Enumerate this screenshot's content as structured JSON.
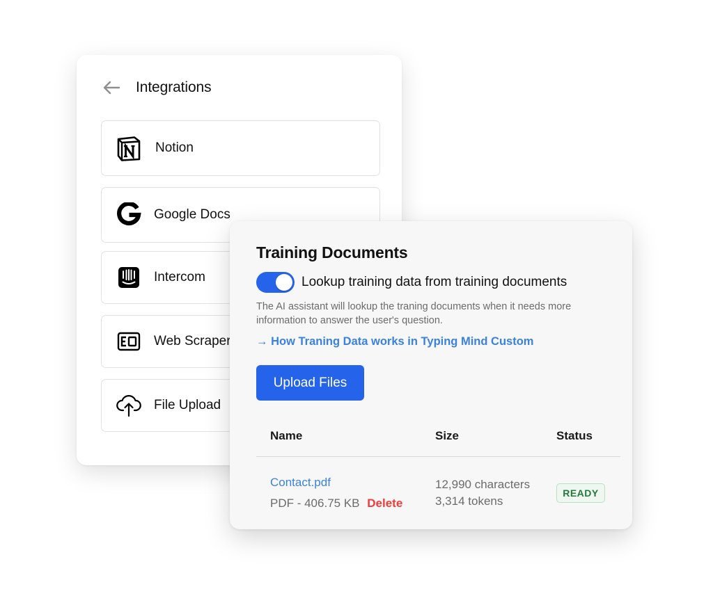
{
  "integrations": {
    "title": "Integrations",
    "back_icon": "arrow-left-icon",
    "items": [
      {
        "label": "Notion",
        "icon": "notion-icon"
      },
      {
        "label": "Google Docs",
        "icon": "google-icon"
      },
      {
        "label": "Intercom",
        "icon": "intercom-icon"
      },
      {
        "label": "Web Scraper",
        "icon": "web-scraper-icon"
      },
      {
        "label": "File Upload",
        "icon": "cloud-upload-icon"
      }
    ]
  },
  "training": {
    "title": "Training Documents",
    "toggle": {
      "on": true,
      "label": "Lookup training data from training documents"
    },
    "description": "The AI assistant will lookup the traning documents when it needs more information to answer the user's question.",
    "link": "→ How Traning Data works in Typing Mind Custom",
    "upload_label": "Upload Files",
    "columns": [
      "Name",
      "Size",
      "Status"
    ],
    "files": [
      {
        "name": "Contact.pdf",
        "meta": "PDF - 406.75 KB",
        "delete_label": "Delete",
        "characters": "12,990 characters",
        "tokens": "3,314 tokens",
        "status": "READY"
      }
    ]
  },
  "colors": {
    "accent": "#2563eb",
    "link": "#3b82e0",
    "danger": "#ef3b3b",
    "success": "#237a3c"
  }
}
